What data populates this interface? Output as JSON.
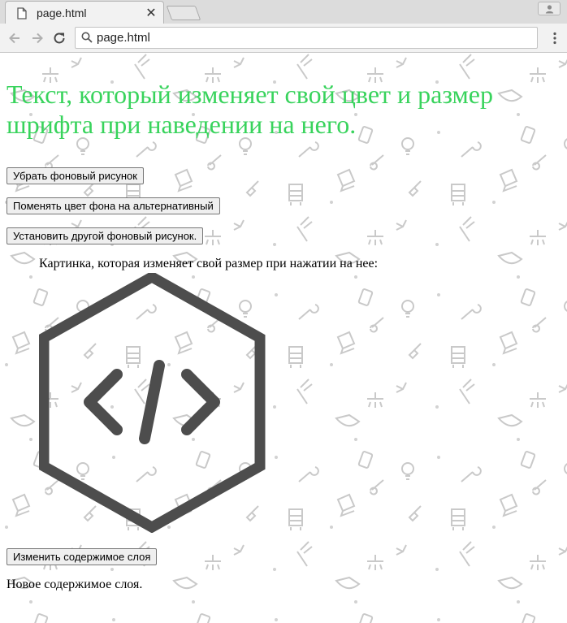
{
  "browser": {
    "tab_title": "page.html",
    "url": "page.html",
    "icons": {
      "tab": "document-icon",
      "close": "close-icon",
      "back": "back-arrow-icon",
      "forward": "forward-arrow-icon",
      "reload": "reload-icon",
      "search": "search-icon",
      "menu": "kebab-menu-icon",
      "profile": "profile-icon"
    }
  },
  "page": {
    "headline": "Текст, который изменяет свой цвет и размер шрифта при наведении на него.",
    "headline_color": "#38d35c",
    "buttons": {
      "remove_bg": "Убрать фоновый рисунок",
      "change_bg_color": "Поменять цвет фона на альтернативный",
      "set_other_bg": "Установить другой фоновый рисунок.",
      "change_layer": "Изменить содержимое слоя"
    },
    "image_caption": "Картинка, которая изменяет свой размер при нажатии на нее:",
    "image_icon": "code-hexagon-icon",
    "layer_content": "Новое содержимое слоя."
  }
}
